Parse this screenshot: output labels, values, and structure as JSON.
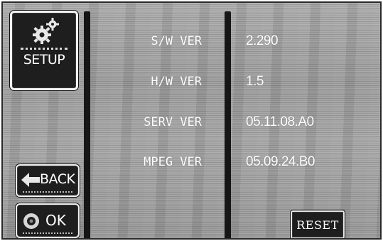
{
  "sidebar": {
    "setup_label": "SETUP",
    "setup_icon": "gears-icon",
    "back_label": "BACK",
    "back_icon": "left-arrow-icon",
    "ok_label": "OK",
    "ok_icon": "disc-icon"
  },
  "info_rows": [
    {
      "label": "S/W VER",
      "value": "2.290"
    },
    {
      "label": "H/W VER",
      "value": "1.5"
    },
    {
      "label": "SERV VER",
      "value": "05.11.08.A0"
    },
    {
      "label": "MPEG VER",
      "value": "05.09.24.B0"
    }
  ],
  "reset_label": "RESET",
  "colors": {
    "panel_background": "#9e9e9e",
    "button_fill": "#1e1e1e",
    "button_border": "#f2f2f2",
    "divider": "#161616",
    "text": "#ffffff"
  }
}
